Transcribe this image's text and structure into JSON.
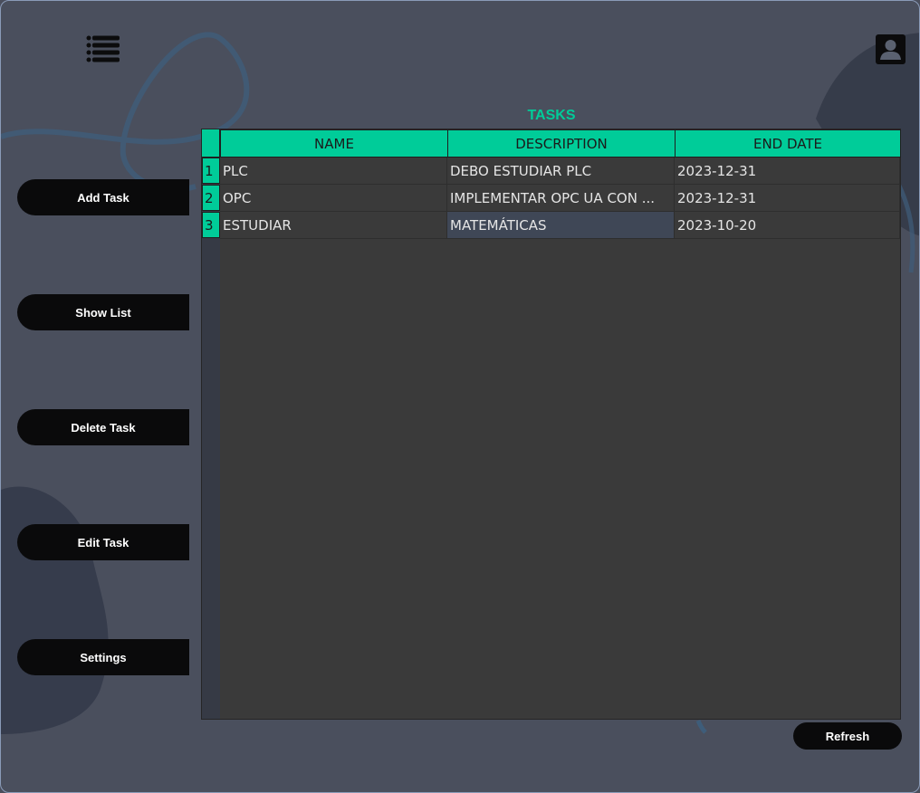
{
  "sidebar": {
    "buttons": [
      {
        "label": "Add Task"
      },
      {
        "label": "Show List"
      },
      {
        "label": "Delete Task"
      },
      {
        "label": "Edit Task"
      },
      {
        "label": "Settings"
      }
    ]
  },
  "header": {
    "menu_icon": "hamburger-list-icon",
    "user_icon": "user-profile-icon"
  },
  "tasks": {
    "title": "TASKS",
    "columns": [
      "NAME",
      "DESCRIPTION",
      "END DATE"
    ],
    "rows": [
      {
        "num": "1",
        "name": "PLC",
        "description": "DEBO ESTUDIAR PLC",
        "end_date": "2023-12-31"
      },
      {
        "num": "2",
        "name": "OPC",
        "description": "IMPLEMENTAR OPC UA CON ...",
        "end_date": "2023-12-31"
      },
      {
        "num": "3",
        "name": "ESTUDIAR",
        "description": "MATEMÁTICAS",
        "end_date": "2023-10-20"
      }
    ]
  },
  "refresh_label": "Refresh",
  "colors": {
    "accent": "#00cc99",
    "background": "#4a4f5d",
    "button": "#0a0a0b",
    "table": "#3a3a3a"
  }
}
